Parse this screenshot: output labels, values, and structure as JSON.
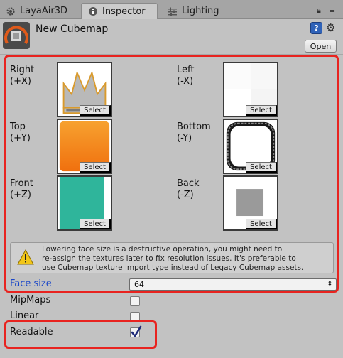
{
  "tabs": [
    {
      "label": "LayaAir3D",
      "icon": "gear-tab-icon"
    },
    {
      "label": "Inspector",
      "icon": "info-tab-icon",
      "active": true
    },
    {
      "label": "Lighting",
      "icon": "sliders-tab-icon"
    }
  ],
  "header": {
    "title": "New Cubemap",
    "help_icon_glyph": "?",
    "open_label": "Open"
  },
  "faces": {
    "right": {
      "name": "Right",
      "axis": "(+X)",
      "select_label": "Select",
      "texture": "crown-texture"
    },
    "left": {
      "name": "Left",
      "axis": "(-X)",
      "select_label": "Select",
      "texture": "white-texture"
    },
    "top": {
      "name": "Top",
      "axis": "(+Y)",
      "select_label": "Select",
      "texture": "orange-texture"
    },
    "bottom": {
      "name": "Bottom",
      "axis": "(-Y)",
      "select_label": "Select",
      "texture": "rounded-frame-texture"
    },
    "front": {
      "name": "Front",
      "axis": "(+Z)",
      "select_label": "Select",
      "texture": "teal-texture"
    },
    "back": {
      "name": "Back",
      "axis": "(-Z)",
      "select_label": "Select",
      "texture": "gray-square-texture"
    }
  },
  "warning": {
    "line1": "Lowering face size is a destructive operation, you might need to",
    "line2": "re-assign the textures later to fix resolution issues. It's preferable to",
    "line3": "use Cubemap texture import type instead of Legacy Cubemap assets."
  },
  "properties": {
    "face_size_label": "Face size",
    "face_size_value": "64",
    "mipmaps_label": "MipMaps",
    "mipmaps_checked": false,
    "linear_label": "Linear",
    "linear_checked": false,
    "readable_label": "Readable",
    "readable_checked": true
  },
  "colors": {
    "highlight": "#e8231f",
    "face_size_label": "#1b47c8",
    "orange": "#f58a1a",
    "teal": "#2fb59b",
    "checkmark": "#1e2a78"
  }
}
